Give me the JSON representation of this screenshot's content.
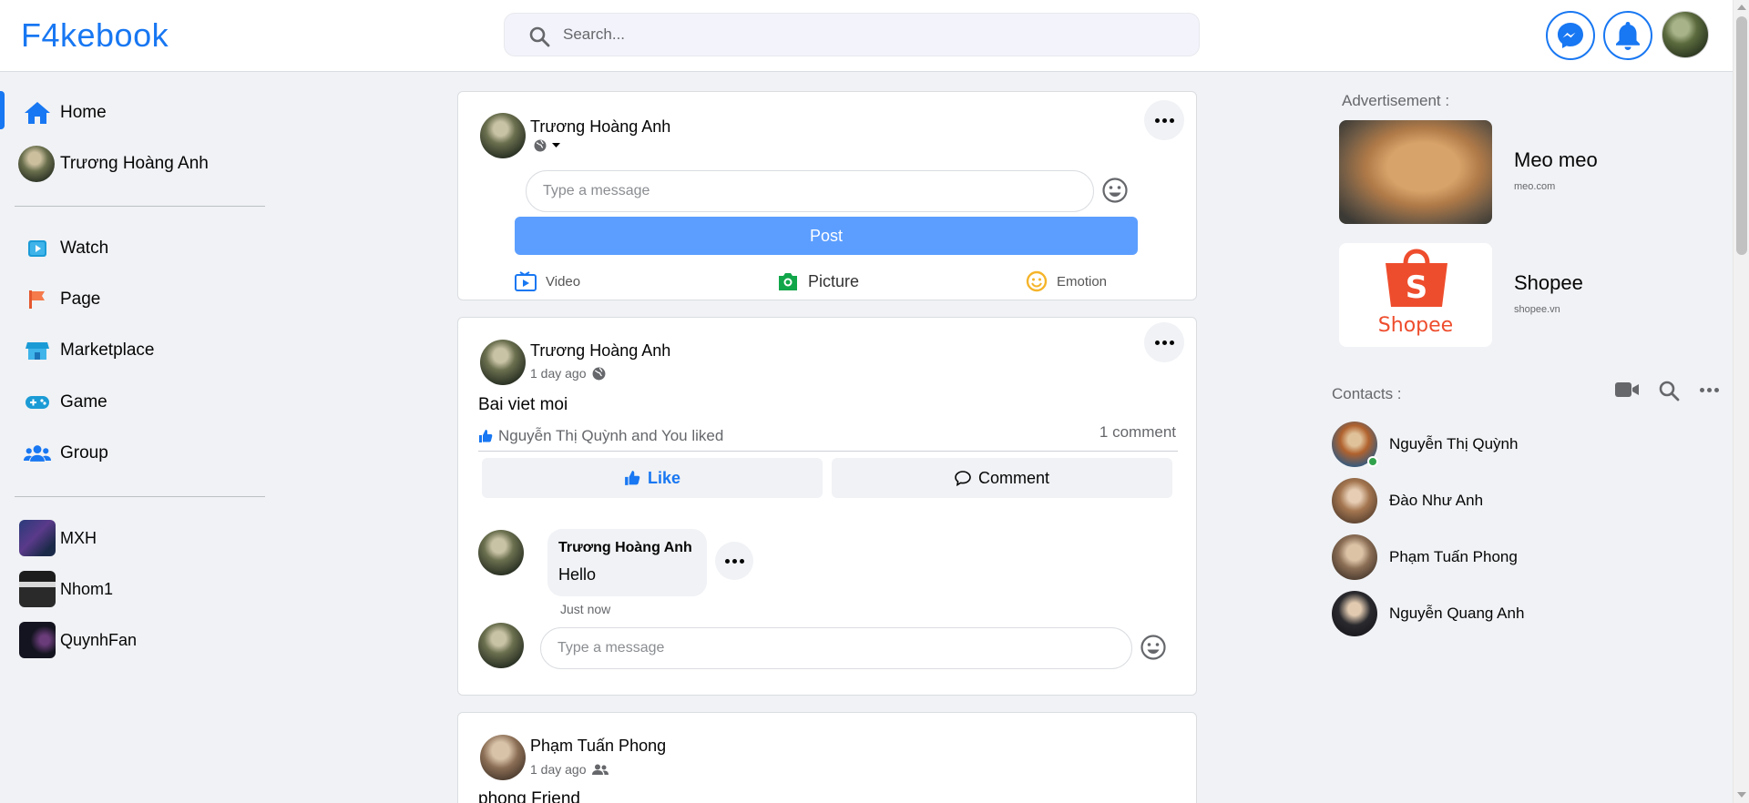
{
  "app": {
    "logo": "F4kebook"
  },
  "search": {
    "placeholder": "Search..."
  },
  "user": {
    "name": "Trương Hoàng Anh"
  },
  "sidebar": {
    "nav": [
      {
        "label": "Home",
        "icon": "home-icon"
      },
      {
        "label": "Trương Hoàng Anh",
        "icon": "avatar"
      },
      {
        "label": "Watch",
        "icon": "watch-icon"
      },
      {
        "label": "Page",
        "icon": "flag-icon"
      },
      {
        "label": "Marketplace",
        "icon": "store-icon"
      },
      {
        "label": "Game",
        "icon": "gamepad-icon"
      },
      {
        "label": "Group",
        "icon": "users-icon"
      }
    ],
    "groups": [
      {
        "label": "MXH"
      },
      {
        "label": "Nhom1"
      },
      {
        "label": "QuynhFan"
      }
    ]
  },
  "composer": {
    "name": "Trương Hoàng Anh",
    "input_placeholder": "Type a message",
    "post_label": "Post",
    "actions": [
      {
        "label": "Video",
        "icon": "video-icon"
      },
      {
        "label": "Picture",
        "icon": "camera-icon"
      },
      {
        "label": "Emotion",
        "icon": "smile-icon"
      }
    ]
  },
  "posts": [
    {
      "author": "Trương Hoàng Anh",
      "time": "1 day ago",
      "text": "Bai viet moi",
      "likes": "Nguyễn Thị Quỳnh and You liked",
      "comments_count": "1 comment",
      "like_label": "Like",
      "comment_label": "Comment",
      "comment": {
        "author": "Trương Hoàng Anh",
        "text": "Hello",
        "time": "Just now"
      },
      "reply_placeholder": "Type a message"
    },
    {
      "author": "Phạm Tuấn Phong",
      "time": "1 day ago",
      "text": "phong Friend"
    }
  ],
  "right": {
    "ads_title": "Advertisement :",
    "ads": [
      {
        "name": "Meo meo",
        "url": "meo.com"
      },
      {
        "name": "Shopee",
        "url": "shopee.vn",
        "brand": "Shopee"
      }
    ],
    "contacts_title": "Contacts :",
    "contacts": [
      {
        "name": "Nguyễn Thị Quỳnh",
        "online": true
      },
      {
        "name": "Đào Như Anh",
        "online": false
      },
      {
        "name": "Phạm Tuấn Phong",
        "online": false
      },
      {
        "name": "Nguyễn Quang Anh",
        "online": false
      }
    ]
  },
  "colors": {
    "brand": "#1877f2",
    "post_button": "#5c9eff",
    "background": "#f0f2f5",
    "online": "#31a24c",
    "shopee": "#ee4d2d"
  }
}
